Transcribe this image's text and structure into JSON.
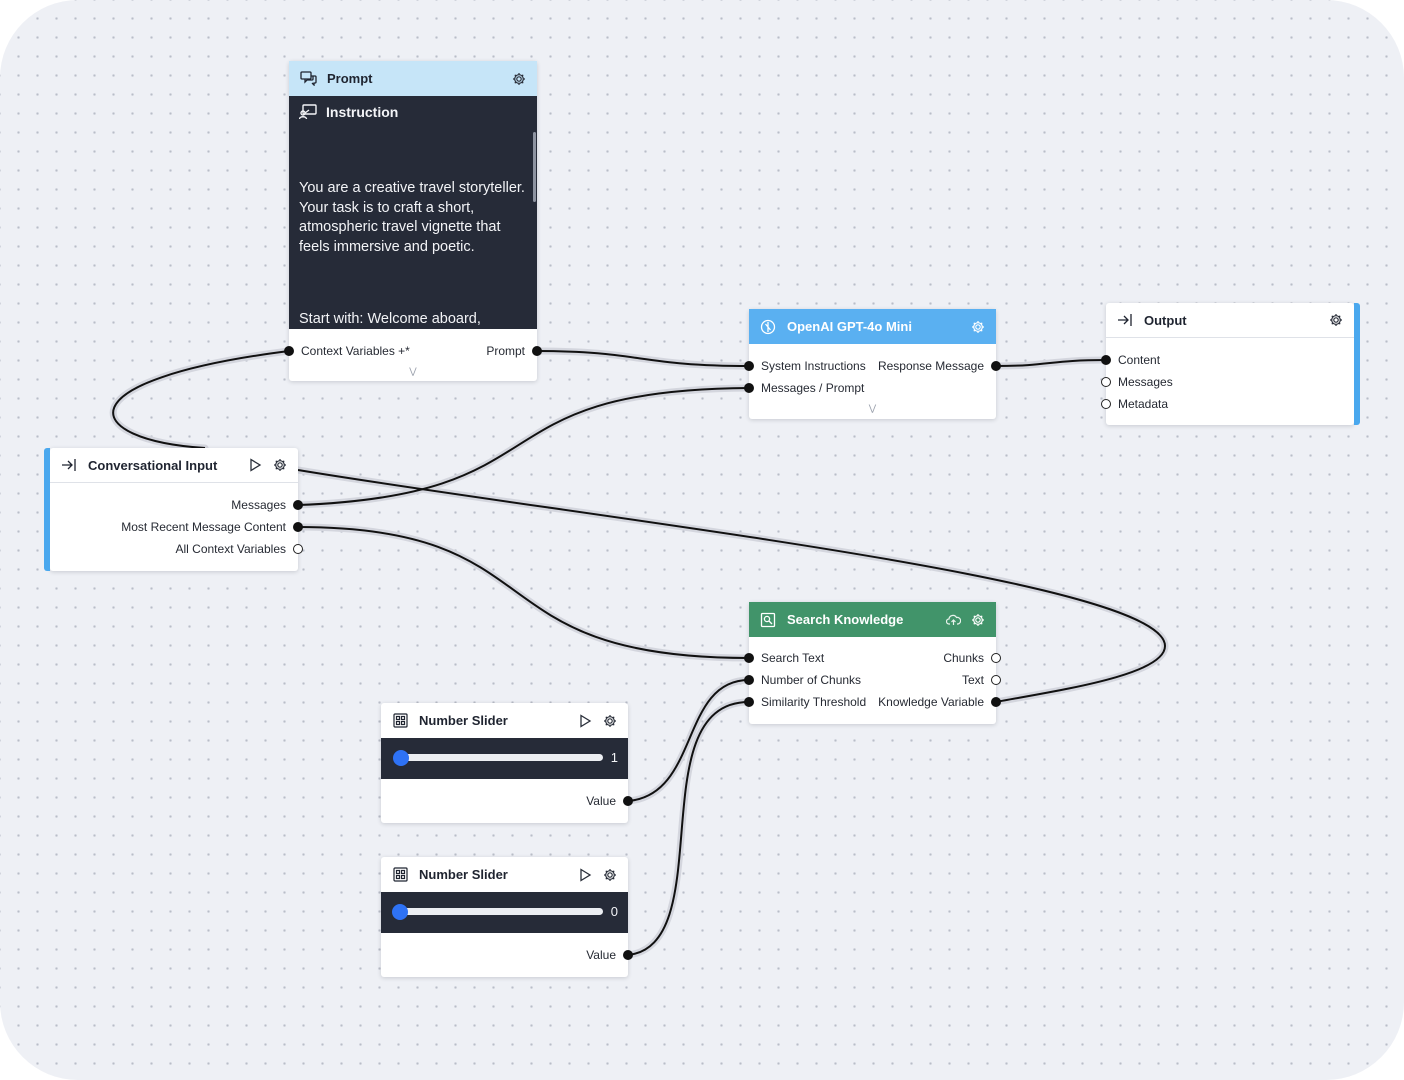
{
  "colors": {
    "prompt_header": "#c6e5f8",
    "openai_header": "#5ab0f1",
    "search_header": "#41946a",
    "accent": "#4aa8ee",
    "dark_panel": "#262b38",
    "canvas": "#eef0f5",
    "wire": "#111111"
  },
  "icons": {
    "prompt": "chat-bubbles-icon",
    "instruction": "instruction-board-icon",
    "openai": "openai-logo-icon",
    "input": "arrow-to-line-icon",
    "output": "arrow-to-line-icon",
    "search": "search-document-icon",
    "slider": "grid-icon",
    "run": "play-icon",
    "settings": "gear-icon",
    "cloud": "cloud-upload-icon",
    "expand": "chevron-double-down-icon"
  },
  "prompt_node": {
    "title": "Prompt",
    "instruction_title": "Instruction",
    "instruction_p1": "You are a creative travel storyteller. Your task is to craft a short, atmospheric travel vignette that feels immersive and poetic.",
    "instruction_p2": "Start with: Welcome aboard, Dianer Flight [random flight number] Destination: [city name]",
    "input_label": "Context Variables +*",
    "output_label": "Prompt"
  },
  "openai_node": {
    "title": "OpenAI GPT-4o Mini",
    "inputs": [
      "System Instructions",
      "Messages / Prompt"
    ],
    "output": "Response Message"
  },
  "output_node": {
    "title": "Output",
    "inputs": [
      "Content",
      "Messages",
      "Metadata"
    ]
  },
  "input_node": {
    "title": "Conversational Input",
    "outputs": [
      "Messages",
      "Most Recent Message Content",
      "All Context Variables"
    ]
  },
  "search_node": {
    "title": "Search Knowledge",
    "inputs": [
      "Search Text",
      "Number of Chunks",
      "Similarity Threshold"
    ],
    "outputs": [
      "Chunks",
      "Text",
      "Knowledge Variable"
    ]
  },
  "slider_1": {
    "title": "Number Slider",
    "value_text": "1",
    "output": "Value"
  },
  "slider_2": {
    "title": "Number Slider",
    "value_text": "0",
    "output": "Value"
  }
}
